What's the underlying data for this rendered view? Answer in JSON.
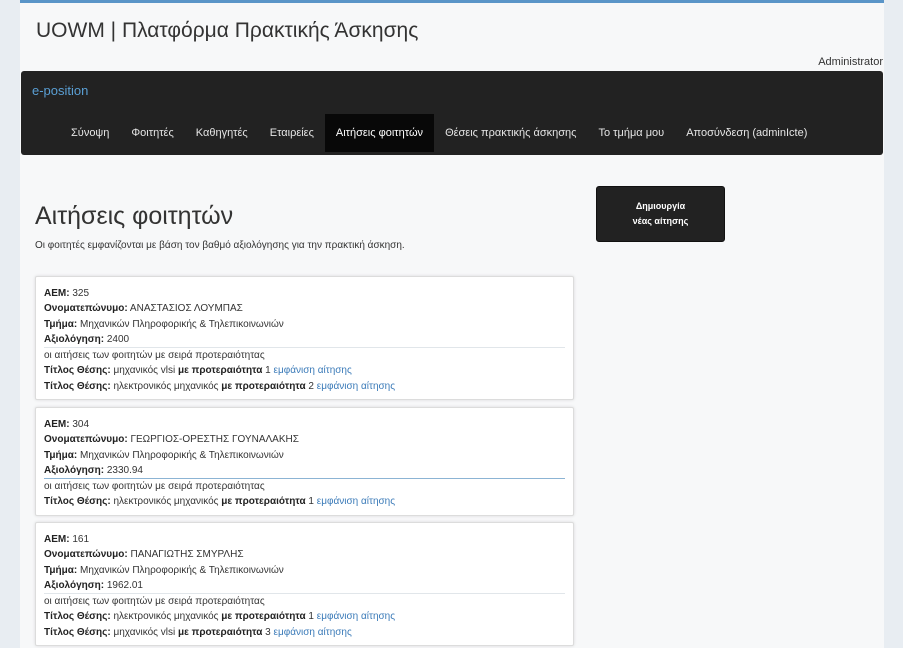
{
  "site": {
    "title": "UOWM | Πλατφόρμα Πρακτικής Άσκησης",
    "user": "Administrator"
  },
  "navbar": {
    "brand": "e-position",
    "items": [
      {
        "label": "Σύνοψη"
      },
      {
        "label": "Φοιτητές"
      },
      {
        "label": "Καθηγητές"
      },
      {
        "label": "Εταιρείες"
      },
      {
        "label": "Αιτήσεις φοιτητών",
        "active": true
      },
      {
        "label": "Θέσεις πρακτικής άσκησης"
      },
      {
        "label": "Το τμήμα μου"
      },
      {
        "label": "Αποσύνδεση (adminIcte)"
      }
    ]
  },
  "main": {
    "heading": "Αιτήσεις φοιτητών",
    "subtitle": "Οι φοιτητές εμφανίζονται με βάση τον βαθμό αξιολόγησης για την πρακτική άσκηση.",
    "create_button": {
      "line1": "Δημιουργία",
      "line2": "νέας αίτησης"
    }
  },
  "labels": {
    "aem": "ΑΕΜ:",
    "name": "Ονοματεπώνυμο:",
    "dept": "Τμήμα:",
    "grade": "Αξιολόγηση:",
    "order_note": "οι αιτήσεις των φοιτητών με σειρά προτεραιότητας",
    "position_title": "Τίτλος Θέσης:",
    "priority": "με προτεραιότητα",
    "view": "εμφάνιση αίτησης"
  },
  "students": [
    {
      "aem": "325",
      "name": "ΑΝΑΣΤΑΣΙΟΣ ΛΟΥΜΠΑΣ",
      "dept": "Μηχανικών Πληροφορικής & Τηλεπικοινωνιών",
      "grade": "2400",
      "applications": [
        {
          "title": "μηχανικός vlsi",
          "priority": "1"
        },
        {
          "title": "ηλεκτρονικός μηχανικός",
          "priority": "2"
        }
      ]
    },
    {
      "aem": "304",
      "name": "ΓΕΩΡΓΙΟΣ-ΟΡΕΣΤΗΣ ΓΟΥΝΑΛΑΚΗΣ",
      "dept": "Μηχανικών Πληροφορικής & Τηλεπικοινωνιών",
      "grade": "2330.94",
      "applications": [
        {
          "title": "ηλεκτρονικός μηχανικός",
          "priority": "1"
        }
      ]
    },
    {
      "aem": "161",
      "name": "ΠΑΝΑΓΙΩΤΗΣ ΣΜΥΡΛΗΣ",
      "dept": "Μηχανικών Πληροφορικής & Τηλεπικοινωνιών",
      "grade": "1962.01",
      "applications": [
        {
          "title": "ηλεκτρονικός μηχανικός",
          "priority": "1"
        },
        {
          "title": "μηχανικός vlsi",
          "priority": "3"
        }
      ]
    }
  ]
}
